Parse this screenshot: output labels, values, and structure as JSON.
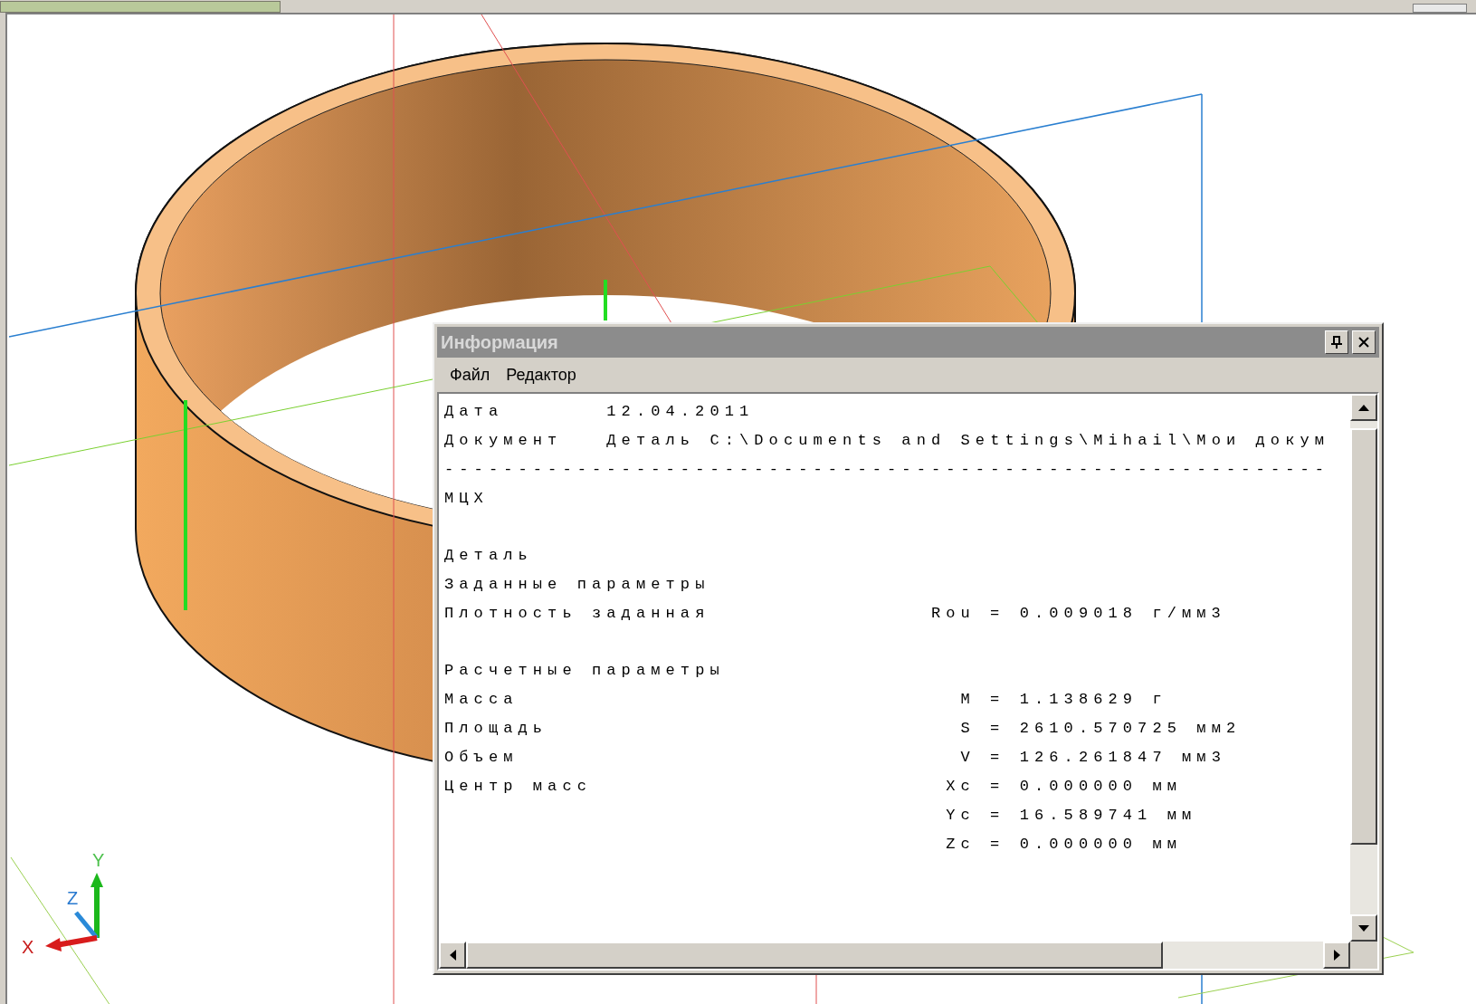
{
  "info_window": {
    "title": "Информация",
    "menu": [
      "Файл",
      "Редактор"
    ],
    "sections": [
      [
        {
          "kind": "field",
          "label": "Дата",
          "value": "12.04.2011"
        },
        {
          "kind": "field",
          "label": "Документ",
          "value": "Деталь C:\\Documents and Settings\\Mihail\\Мои докум"
        },
        {
          "kind": "rule",
          "text": "------------------------------------------------------------"
        },
        {
          "kind": "text",
          "text": "МЦХ"
        }
      ],
      [
        {
          "kind": "text",
          "text": "Деталь"
        },
        {
          "kind": "text",
          "text": "Заданные параметры"
        },
        {
          "kind": "param",
          "label": "Плотность заданная",
          "value": "Rou = 0.009018 г/мм3"
        }
      ],
      [
        {
          "kind": "text",
          "text": "Расчетные параметры"
        },
        {
          "kind": "param",
          "label": "Масса",
          "value": "M = 1.138629 г"
        },
        {
          "kind": "param",
          "label": "Площадь",
          "value": "S = 2610.570725 мм2"
        },
        {
          "kind": "param",
          "label": "Объем",
          "value": "V = 126.261847 мм3"
        },
        {
          "kind": "param",
          "label": "Центр масс",
          "value": "Xc = 0.000000 мм"
        },
        {
          "kind": "param",
          "value": "Yc = 16.589741 мм"
        },
        {
          "kind": "param",
          "value": "Zc = 0.000000 мм"
        }
      ]
    ]
  },
  "axes": {
    "x": "X",
    "y": "Y",
    "z": "Z"
  }
}
